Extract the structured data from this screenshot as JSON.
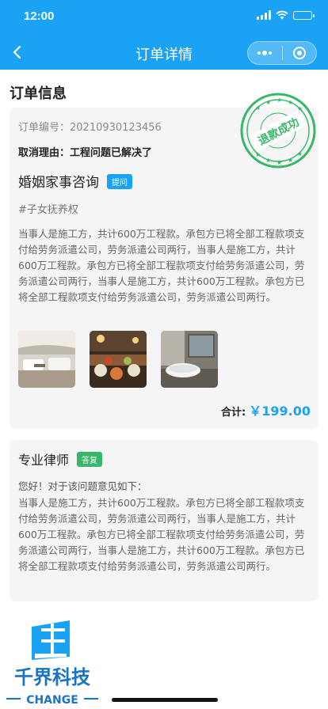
{
  "status_bar": {
    "time": "12:00"
  },
  "nav": {
    "title": "订单详情"
  },
  "section": {
    "title": "订单信息"
  },
  "order": {
    "order_no_label": "订单编号：20210930123456",
    "cancel_reason": "取消理由：工程问题已解决了",
    "question_title": "婚姻家事咨询",
    "question_tag": "提问",
    "hashtag": "#子女抚养权",
    "content": "当事人是施工方，共计600万工程款。承包方已将全部工程款项支付给劳务派遣公司，劳务派遣公司两行，当事人是施工方，共计600万工程款。承包方已将全部工程款项支付给劳务派遣公司，劳务派遣公司两行，当事人是施工方，共计600万工程款。承包方已将全部工程款项支付给劳务派遣公司，劳务派遣公司两行。",
    "images": [
      "lounge-photo",
      "buffet-photo",
      "bathroom-photo"
    ],
    "total_label": "合计:",
    "total_amount": "￥199.00"
  },
  "stamp": {
    "text": "退款成功",
    "color": "#37b76a"
  },
  "answer": {
    "lawyer": "专业律师",
    "tag": "答复",
    "greeting": "您好！对于该问题意见如下：",
    "content": "当事人是施工方，共计600万工程款。承包方已将全部工程款项支付给劳务派遣公司，劳务派遣公司两行，当事人是施工方，共计600万工程款。承包方已将全部工程款项支付给劳务派遣公司，劳务派遣公司两行，当事人是施工方，共计600万工程款。承包方已将全部工程款项支付给劳务派遣公司，劳务派遣公司两行。"
  },
  "watermark": {
    "name": "千界科技",
    "sub": "CHANGE"
  },
  "colors": {
    "primary": "#1aa3f5",
    "green": "#37b76a",
    "card_bg": "#f5f5f5"
  }
}
